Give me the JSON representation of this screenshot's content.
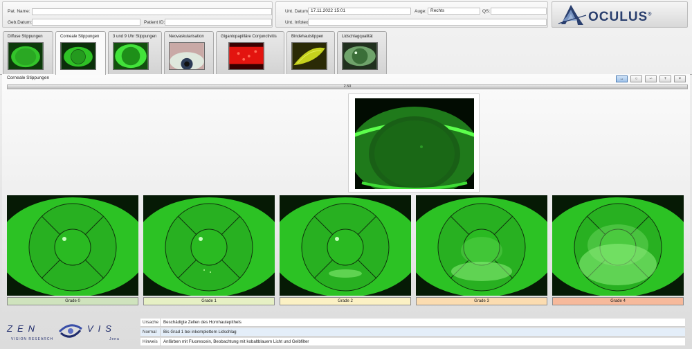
{
  "patient": {
    "name_label": "Pat. Name:",
    "name_value": "",
    "dob_label": "Geb.Datum:",
    "dob_value": "",
    "id_label": "Patient ID:",
    "id_value": ""
  },
  "exam": {
    "date_label": "Unt. Datum:",
    "date_value": "17.11.2022 15:01",
    "eye_label": "Auge:",
    "eye_value": "Rechts",
    "qs_label": "QS:",
    "qs_value": "",
    "info_label": "Unt. Infotext:",
    "info_value": ""
  },
  "brand": {
    "name": "OCULUS",
    "mark": "®"
  },
  "tabs": [
    {
      "label": "Diffuse Stippungen",
      "active": false
    },
    {
      "label": "Corneale Stippungen",
      "active": true
    },
    {
      "label": "3 und 9 Uhr Stippungen",
      "active": false
    },
    {
      "label": "Neovaskularisation",
      "active": false
    },
    {
      "label": "Gigantopapilläre Conjunctivitis",
      "active": false
    },
    {
      "label": "Bindehautstippen",
      "active": false
    },
    {
      "label": "Lidschlagqualität",
      "active": false
    }
  ],
  "main": {
    "title": "Corneale Stippungen",
    "scale_value": "2.50",
    "tools": [
      "↔",
      "○",
      "∽",
      "+",
      "⌖"
    ]
  },
  "grades": [
    {
      "label": "Grade 0",
      "color": "#cfe3bd"
    },
    {
      "label": "Grade 1",
      "color": "#e6f0c4"
    },
    {
      "label": "Grade 2",
      "color": "#fbf1c4"
    },
    {
      "label": "Grade 3",
      "color": "#fbdcb0"
    },
    {
      "label": "Grade 4",
      "color": "#f6b99b"
    }
  ],
  "info": [
    {
      "key": "Ursache",
      "value": "Beschädigte Zellen des Hornhautepithels"
    },
    {
      "key": "Normal",
      "value": "Bis Grad 1 bei inkomplettem Lidschlag"
    },
    {
      "key": "Hinweis",
      "value": "Anfärben mit Fluorescein, Beobachtung mit kobaltblauem Licht und Gelbfilter"
    }
  ],
  "footer_logo": {
    "word_left": "ZEN",
    "word_right": "VIS",
    "tagline": "VISION RESEARCH",
    "city": "Jena"
  },
  "colors": {
    "accent": "#2a3f6e",
    "fluorescein": "#2fe22a"
  }
}
